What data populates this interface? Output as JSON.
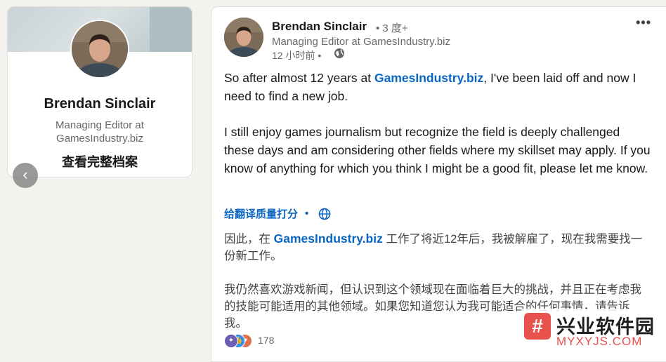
{
  "profile_card": {
    "name": "Brendan Sinclair",
    "headline_line1": "Managing Editor at",
    "headline_line2": "GamesIndustry.biz",
    "view_profile": "查看完整档案",
    "carousel_prev_icon": "chevron-left-icon"
  },
  "post": {
    "author": "Brendan Sinclair",
    "degree": "• 3 度+",
    "headline": "Managing Editor at GamesIndustry.biz",
    "time": "12 小时前 •",
    "more_icon": "•••",
    "body": {
      "p1_before": "So after almost 12 years at ",
      "p1_link": "GamesIndustry.biz",
      "p1_after": ", I've been laid off and now I need to find a new job.",
      "p2": "I still enjoy games journalism but recognize the field is deeply challenged these days and am considering other fields where my skillset may apply. If you know of anything for which you think I might be a good fit, please let me know."
    },
    "translate_rate": "给翻译质量打分",
    "translate_sep": "•",
    "translated": {
      "p1_before": "因此，在 ",
      "p1_link": "GamesIndustry.biz",
      "p1_after": " 工作了将近12年后，我被解雇了，现在我需要找一份新工作。",
      "p2": "我仍然喜欢游戏新闻，但认识到这个领域现在面临着巨大的挑战，并且正在考虑我的技能可能适用的其他领域。如果您知道您认为我可能适合的任何事情，请告诉我。"
    },
    "reaction_count": "178"
  },
  "watermark": {
    "logo": "#",
    "title": "兴业软件园",
    "url": "MYXYJS.COM"
  },
  "colors": {
    "link_blue": "#0a66c2",
    "page_bg": "#f4f2ee",
    "watermark_red": "#e8514c"
  }
}
